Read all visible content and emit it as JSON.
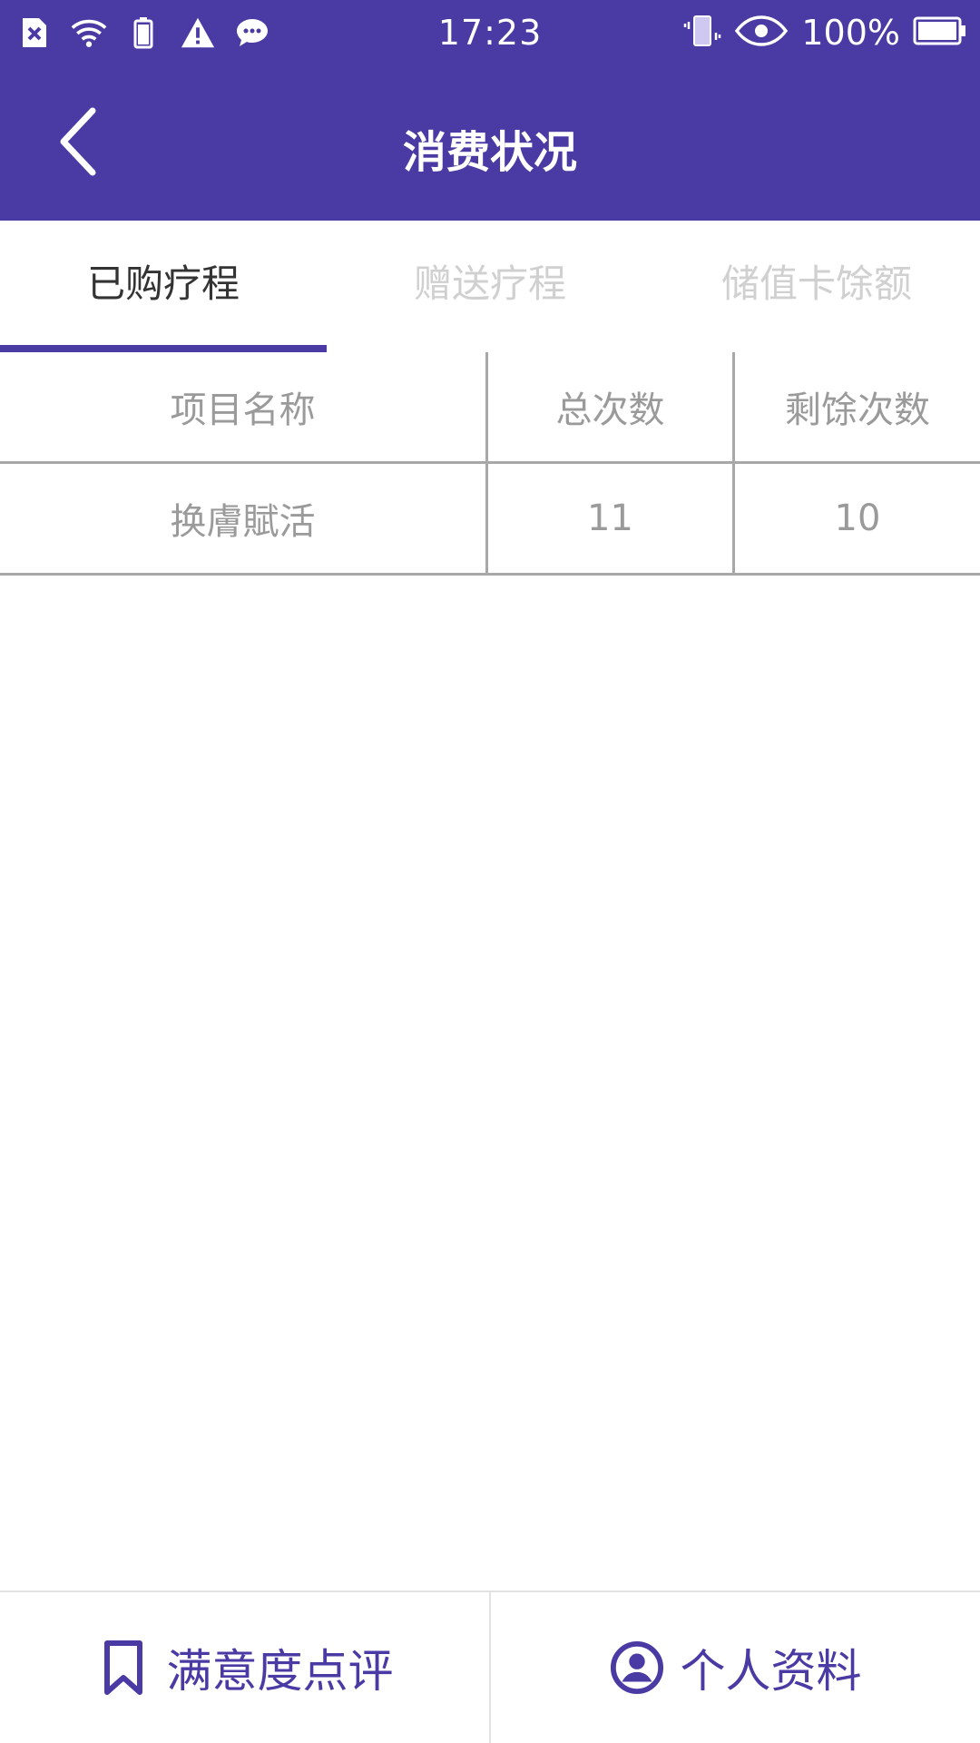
{
  "status_bar": {
    "time": "17:23",
    "battery_percent": "100%",
    "icons": [
      "sim-x-icon",
      "wifi-icon",
      "battery-small-icon",
      "warning-icon",
      "message-icon",
      "vibrate-icon",
      "eye-icon",
      "battery-icon"
    ]
  },
  "header": {
    "title": "消费状况"
  },
  "tabs": [
    {
      "label": "已购疗程",
      "active": true
    },
    {
      "label": "赠送疗程",
      "active": false
    },
    {
      "label": "储值卡馀额",
      "active": false
    }
  ],
  "table": {
    "columns": [
      "项目名称",
      "总次数",
      "剩馀次数"
    ],
    "rows": [
      [
        "换膚賦活",
        "11",
        "10"
      ]
    ]
  },
  "bottom_nav": {
    "items": [
      {
        "label": "满意度点评",
        "icon": "bookmark-icon"
      },
      {
        "label": "个人资料",
        "icon": "profile-icon"
      }
    ]
  },
  "colors": {
    "primary": "#4a3aa4",
    "tab_inactive": "#d0d0d0",
    "table_text": "#9a9a9a"
  }
}
